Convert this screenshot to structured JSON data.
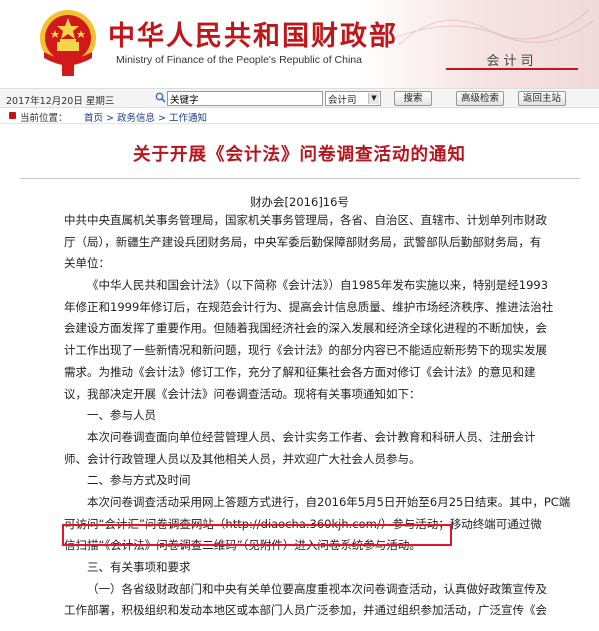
{
  "header": {
    "title_cn": "中华人民共和国财政部",
    "title_en": "Ministry of Finance of the People's Republic of China",
    "department": "会计司",
    "emblem": "national-emblem",
    "colors": {
      "brand_red": "#c0161a",
      "title_red": "#b3161d",
      "highlight": "#e0162b"
    }
  },
  "searchbar": {
    "date": "2017年12月20日  星期三",
    "search_value": "关键字",
    "scope_value": "会计司",
    "search_button": "搜索",
    "advanced_button": "高级检索",
    "home_button": "返回主站"
  },
  "breadcrumb": {
    "label": "当前位置：",
    "path": "首页 > 政务信息 > 工作通知"
  },
  "article": {
    "title": "关于开展《会计法》问卷调查活动的通知",
    "doc_number": "财办会[2016]16号",
    "lines": [
      "中共中央直属机关事务管理局，国家机关事务管理局，各省、自治区、直辖市、计划单列市财政",
      "厅（局），新疆生产建设兵团财务局，中央军委后勤保障部财务局，武警部队后勤部财务局，有",
      "关单位：",
      "《中华人民共和国会计法》（以下简称《会计法》）自1985年发布实施以来，特别是经1993",
      "年修正和1999年修订后，在规范会计行为、提高会计信息质量、维护市场经济秩序、推进法治社",
      "会建设方面发挥了重要作用。但随着我国经济社会的深入发展和经济全球化进程的不断加快，会",
      "计工作出现了一些新情况和新问题，现行《会计法》的部分内容已不能适应新形势下的现实发展",
      "需求。为推动《会计法》修订工作，充分了解和征集社会各方面对修订《会计法》的意见和建",
      "议，我部决定开展《会计法》问卷调查活动。现将有关事项通知如下：",
      "一、参与人员",
      "本次问卷调查面向单位经营管理人员、会计实务工作者、会计教育和科研人员、注册会计",
      "师、会计行政管理人员以及其他相关人员，并欢迎广大社会人员参与。",
      "二、参与方式及时间",
      "本次问卷调查活动采用网上答题方式进行，自2016年5月5日开始至6月25日结束。其中，PC端",
      "可访问“会计汇”问卷调查网站（http://diaocha.360kjh.com/）参与活动；移动终端可通过微",
      "信扫描“《会计法》问卷调查二维码”（见附件）进入问卷系统参与活动。",
      "三、有关事项和要求",
      "（一）各省级财政部门和中央有关单位要高度重视本次问卷调查活动，认真做好政策宣传及",
      "工作部署，积极组织和发动本地区或本部门人员广泛参加，并通过组织参加活动，广泛宣传《会"
    ],
    "indented_lines": [
      3,
      9,
      10,
      12,
      13,
      16,
      17
    ]
  }
}
